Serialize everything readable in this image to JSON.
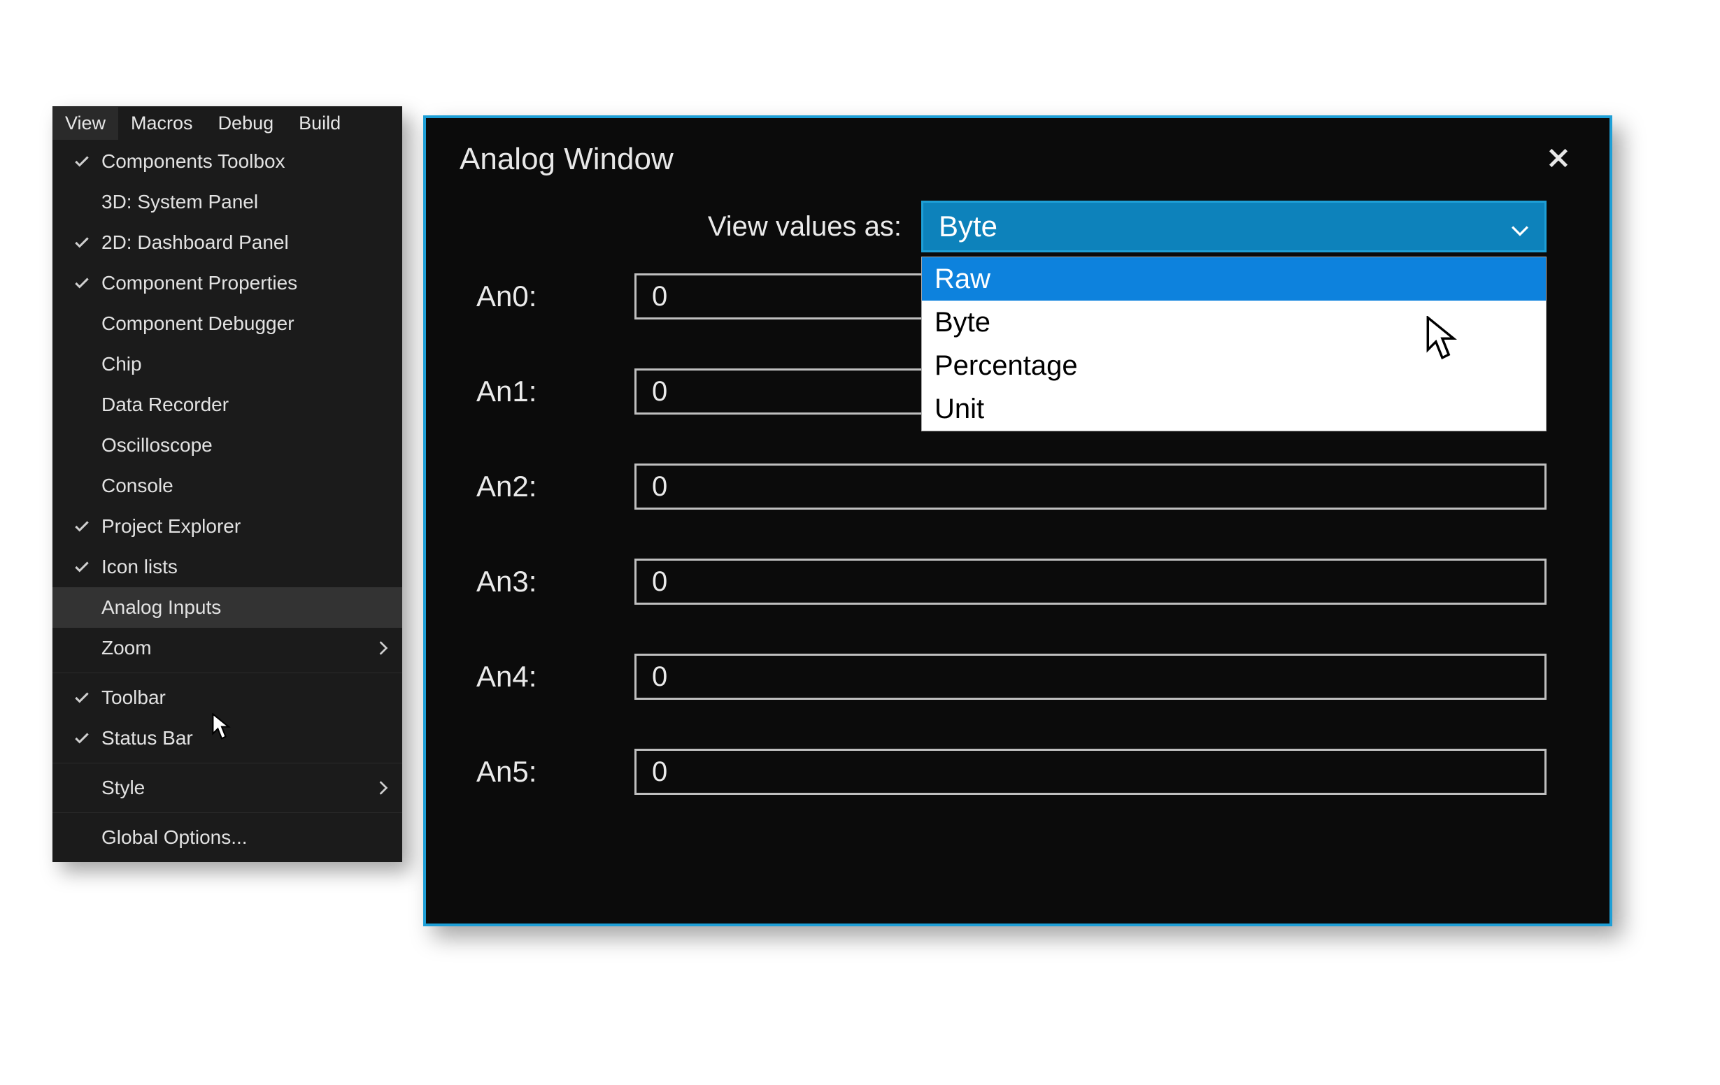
{
  "menuBar": {
    "items": [
      "View",
      "Macros",
      "Debug",
      "Build"
    ],
    "activeIndex": 0
  },
  "viewMenu": {
    "items": [
      {
        "label": "Components Toolbox",
        "checked": true,
        "submenu": false
      },
      {
        "label": "3D: System Panel",
        "checked": false,
        "submenu": false
      },
      {
        "label": "2D: Dashboard Panel",
        "checked": true,
        "submenu": false
      },
      {
        "label": "Component Properties",
        "checked": true,
        "submenu": false
      },
      {
        "label": "Component Debugger",
        "checked": false,
        "submenu": false
      },
      {
        "label": "Chip",
        "checked": false,
        "submenu": false
      },
      {
        "label": "Data Recorder",
        "checked": false,
        "submenu": false
      },
      {
        "label": "Oscilloscope",
        "checked": false,
        "submenu": false
      },
      {
        "label": "Console",
        "checked": false,
        "submenu": false
      },
      {
        "label": "Project Explorer",
        "checked": true,
        "submenu": false
      },
      {
        "label": "Icon lists",
        "checked": true,
        "submenu": false
      },
      {
        "label": "Analog Inputs",
        "checked": false,
        "submenu": false,
        "hovered": true
      },
      {
        "label": "Zoom",
        "checked": false,
        "submenu": true
      }
    ],
    "group2": [
      {
        "label": "Toolbar",
        "checked": true,
        "submenu": false
      },
      {
        "label": "Status Bar",
        "checked": true,
        "submenu": false
      }
    ],
    "group3": [
      {
        "label": "Style",
        "checked": false,
        "submenu": true
      }
    ],
    "group4": [
      {
        "label": "Global Options...",
        "checked": false,
        "submenu": false
      }
    ]
  },
  "analog": {
    "title": "Analog Window",
    "viewAsLabel": "View values as:",
    "combo": {
      "selected": "Byte",
      "options": [
        "Raw",
        "Byte",
        "Percentage",
        "Unit"
      ],
      "highlightIndex": 0
    },
    "channels": [
      {
        "label": "An0:",
        "value": "0"
      },
      {
        "label": "An1:",
        "value": "0"
      },
      {
        "label": "An2:",
        "value": "0"
      },
      {
        "label": "An3:",
        "value": "0"
      },
      {
        "label": "An4:",
        "value": "0"
      },
      {
        "label": "An5:",
        "value": "0"
      }
    ]
  }
}
